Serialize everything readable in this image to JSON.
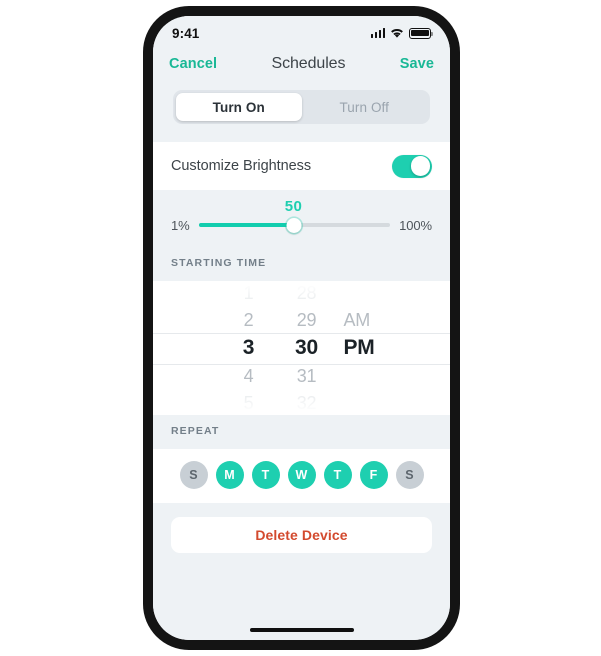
{
  "status_bar": {
    "time": "9:41",
    "icons": [
      "signal-icon",
      "wifi-icon",
      "battery-icon"
    ]
  },
  "nav": {
    "cancel_label": "Cancel",
    "title": "Schedules",
    "save_label": "Save"
  },
  "segmented_control": {
    "options": [
      {
        "label": "Turn On",
        "selected": true
      },
      {
        "label": "Turn Off",
        "selected": false
      }
    ]
  },
  "brightness": {
    "label": "Customize Brightness",
    "toggle_on": true,
    "slider": {
      "value": "50",
      "min_label": "1%",
      "max_label": "100%",
      "percent": 50
    }
  },
  "starting_time": {
    "header": "STARTING TIME",
    "hours": [
      "1",
      "2",
      "3",
      "4",
      "5"
    ],
    "minutes": [
      "28",
      "29",
      "30",
      "31",
      "32"
    ],
    "meridiem": [
      "",
      "AM",
      "PM",
      "",
      ""
    ],
    "selected_hour": "3",
    "selected_minute": "30",
    "selected_meridiem": "PM"
  },
  "repeat": {
    "header": "REPEAT",
    "days": [
      {
        "letter": "S",
        "selected": false
      },
      {
        "letter": "M",
        "selected": true
      },
      {
        "letter": "T",
        "selected": true
      },
      {
        "letter": "W",
        "selected": true
      },
      {
        "letter": "T",
        "selected": true
      },
      {
        "letter": "F",
        "selected": true
      },
      {
        "letter": "S",
        "selected": false
      }
    ]
  },
  "delete": {
    "label": "Delete Device"
  },
  "colors": {
    "accent": "#1ecfb0",
    "link": "#19b896",
    "danger": "#d34a2e",
    "background": "#eef2f5",
    "card": "#ffffff"
  }
}
